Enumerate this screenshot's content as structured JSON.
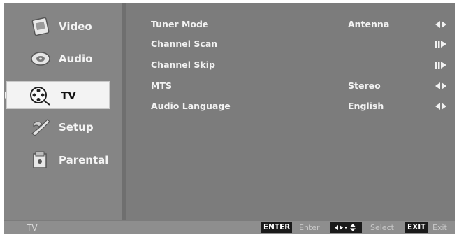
{
  "sidebar": {
    "items": [
      {
        "label": "Video",
        "icon": "video-icon",
        "active": false
      },
      {
        "label": "Audio",
        "icon": "audio-icon",
        "active": false
      },
      {
        "label": "TV",
        "icon": "tv-reel-icon",
        "active": true
      },
      {
        "label": "Setup",
        "icon": "setup-icon",
        "active": false
      },
      {
        "label": "Parental",
        "icon": "parental-icon",
        "active": false
      }
    ]
  },
  "settings": {
    "rows": [
      {
        "label": "Tuner Mode",
        "value": "Antenna",
        "control": "left-right-arrows-icon"
      },
      {
        "label": "Channel Scan",
        "value": "",
        "control": "enter-arrow-icon"
      },
      {
        "label": "Channel Skip",
        "value": "",
        "control": "enter-arrow-icon"
      },
      {
        "label": "MTS",
        "value": "Stereo",
        "control": "left-right-arrows-icon"
      },
      {
        "label": "Audio Language",
        "value": "English",
        "control": "left-right-arrows-icon"
      }
    ]
  },
  "footer": {
    "title": "TV",
    "enter_key": "ENTER",
    "enter_label": "Enter",
    "select_label": "Select",
    "exit_key": "EXIT",
    "exit_label": "Exit"
  },
  "colors": {
    "background": "#7c7c7c",
    "active_highlight": "#f3f3f3",
    "text": "#f2f2f2"
  }
}
